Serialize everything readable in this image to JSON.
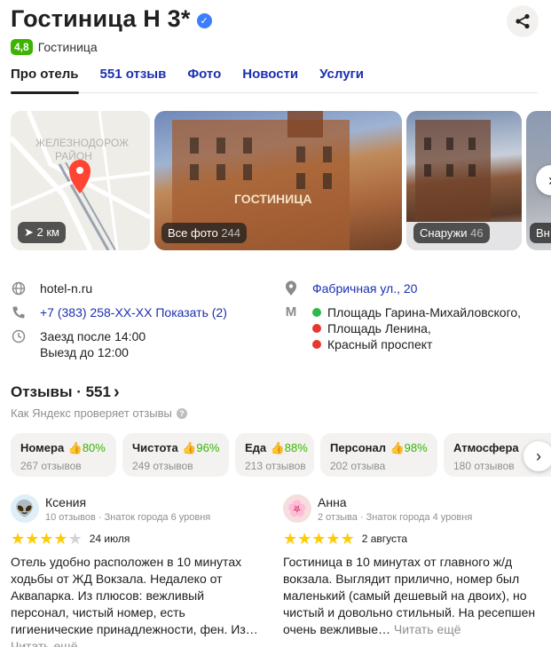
{
  "header": {
    "title": "Гостиница Н 3*",
    "rating": "4,8",
    "category": "Гостиница"
  },
  "tabs": [
    {
      "label": "Про отель",
      "active": true
    },
    {
      "label": "551 отзыв"
    },
    {
      "label": "Фото"
    },
    {
      "label": "Новости"
    },
    {
      "label": "Услуги"
    }
  ],
  "gallery": {
    "map_district": "ЖЕЛЕЗНОДОРОЖНЫЙ РАЙОН",
    "distance": "2 км",
    "all_photos_label": "Все фото",
    "all_photos_count": "244",
    "outside_label": "Снаружи",
    "outside_count": "46",
    "partial_label": "Вн"
  },
  "info": {
    "website": "hotel-n.ru",
    "phone": "+7 (383) 258-XX-XX Показать (2)",
    "checkin": "Заезд после 14:00",
    "checkout": "Выезд до 12:00",
    "address": "Фабричная ул., 20",
    "metro": [
      {
        "name": "Площадь Гарина-Михайловского,",
        "color": "#2fb84a"
      },
      {
        "name": "Площадь Ленина,",
        "color": "#e8372c"
      },
      {
        "name": "Красный проспект",
        "color": "#e8372c"
      }
    ]
  },
  "reviews_section": {
    "title": "Отзывы · 551",
    "subtitle": "Как Яндекс проверяет отзывы"
  },
  "aspects": [
    {
      "name": "Номера",
      "percent": "80%",
      "count": "267 отзывов"
    },
    {
      "name": "Чистота",
      "percent": "96%",
      "count": "249 отзывов"
    },
    {
      "name": "Еда",
      "percent": "88%",
      "count": "213 отзывов"
    },
    {
      "name": "Персонал",
      "percent": "98%",
      "count": "202 отзыва"
    },
    {
      "name": "Атмосфера",
      "percent": "",
      "count": "180 отзывов"
    }
  ],
  "reviews": [
    {
      "name": "Ксения",
      "meta": "10 отзывов · Знаток города 6 уровня",
      "stars": 4,
      "date": "24 июля",
      "text": "Отель удобно расположен в 10 минутах ходьбы от ЖД Вокзала. Недалеко от Аквапарка. Из плюсов: вежливый персонал, чистый номер, есть гигиенические принадлежности, фен. Из…",
      "more": "Читать ещё"
    },
    {
      "name": "Анна",
      "meta": "2 отзыва · Знаток города 4 уровня",
      "stars": 5,
      "date": "2 августа",
      "text": "Гостиница в 10 минутах от главного ж/д вокзала. Выглядит прилично, номер был маленький (самый дешевый на двоих), но чистый и довольно стильный. На ресепшен очень вежливые…",
      "more": "Читать ещё"
    }
  ]
}
